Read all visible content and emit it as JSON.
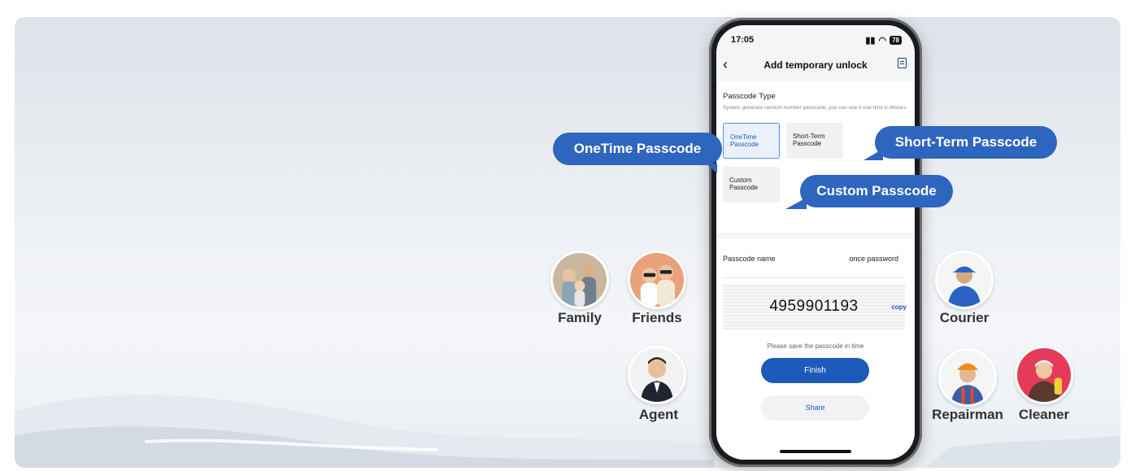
{
  "phone": {
    "status": {
      "time": "17:05",
      "battery": "78"
    },
    "nav": {
      "title": "Add temporary unlock"
    },
    "passcode_type": {
      "label": "Passcode Type",
      "description": "System generate random number passcode, you can use it one time in 6hours",
      "options": [
        {
          "line1": "OneTime",
          "line2": "Passcode"
        },
        {
          "line1": "Short-Term",
          "line2": "Passcode"
        },
        {
          "line1": "Custom",
          "line2": "Passcode"
        }
      ]
    },
    "passcode_name": {
      "label": "Passcode name",
      "value": "once password"
    },
    "passcode": {
      "code": "4959901193",
      "copy": "copy"
    },
    "hint": "Please save the passcode in time",
    "finish": "Finish",
    "share": "Share"
  },
  "callouts": {
    "onetime": "OneTime Passcode",
    "shortterm": "Short-Term Passcode",
    "custom": "Custom Passcode"
  },
  "people": {
    "family": "Family",
    "friends": "Friends",
    "agent": "Agent",
    "courier": "Courier",
    "repairman": "Repairman",
    "cleaner": "Cleaner"
  },
  "colors": {
    "accent": "#2e65bf",
    "button": "#1c5bb9"
  }
}
